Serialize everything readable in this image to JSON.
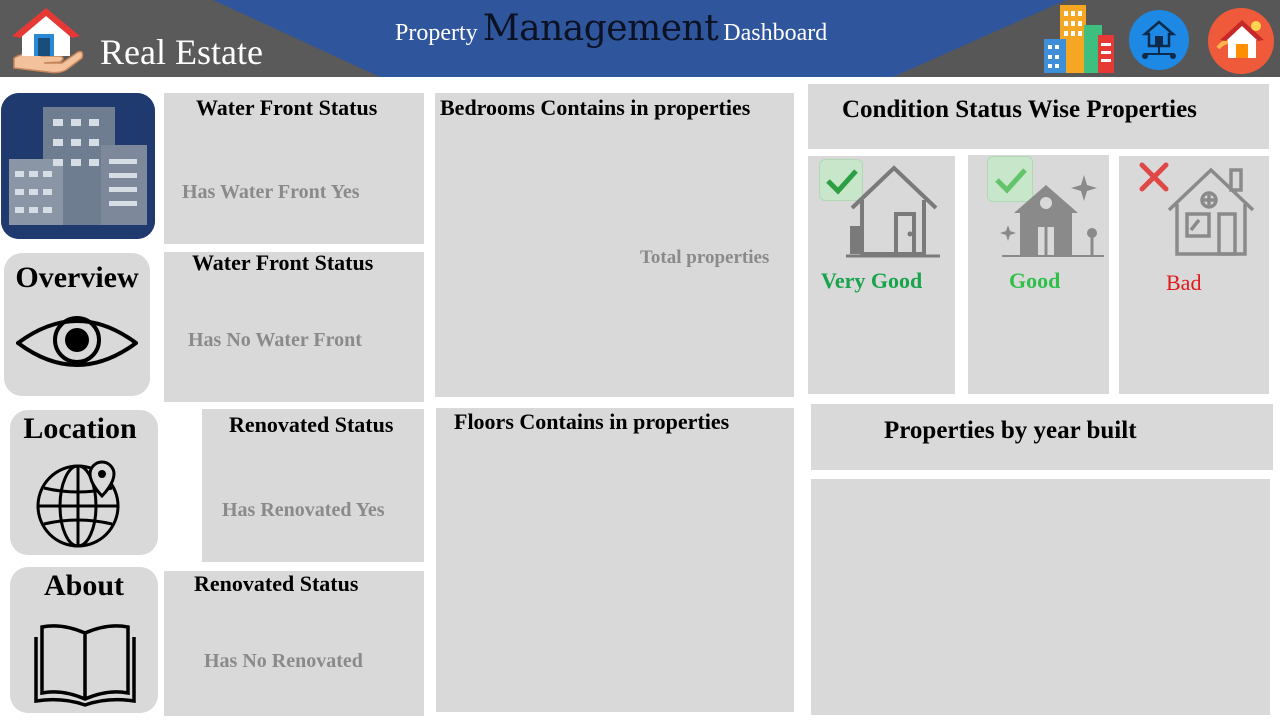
{
  "header": {
    "brand": "Real Estate",
    "title_prefix": "Property",
    "title_main": "Management",
    "title_suffix": "Dashboard",
    "icons": [
      "house-hand-icon",
      "city-buildings-icon",
      "house-network-icon",
      "house-sale-icon"
    ]
  },
  "nav": {
    "items": [
      {
        "label": "Overview",
        "icon": "eye-icon"
      },
      {
        "label": "Location",
        "icon": "globe-pin-icon"
      },
      {
        "label": "About",
        "icon": "book-icon"
      }
    ]
  },
  "water_front": [
    {
      "title": "Water Front Status",
      "value": "Has Water Front Yes"
    },
    {
      "title": "Water Front Status",
      "value": "Has No Water Front"
    }
  ],
  "renovated": [
    {
      "title": "Renovated Status",
      "value": "Has Renovated Yes"
    },
    {
      "title": "Renovated Status",
      "value": "Has No Renovated"
    }
  ],
  "bedrooms": {
    "title": "Bedrooms Contains in properties",
    "note": "Total properties"
  },
  "floors": {
    "title": "Floors Contains in properties"
  },
  "condition": {
    "title": "Condition Status Wise Properties",
    "items": [
      {
        "label": "Very Good",
        "color": "#19a34a",
        "mark": "check"
      },
      {
        "label": "Good",
        "color": "#2ec04b",
        "mark": "check"
      },
      {
        "label": "Bad",
        "color": "#e01919",
        "mark": "cross"
      }
    ]
  },
  "year_built": {
    "title": "Properties by year built"
  },
  "colors": {
    "header_blue": "#2f559c",
    "panel_gray": "#d9d9d9"
  }
}
